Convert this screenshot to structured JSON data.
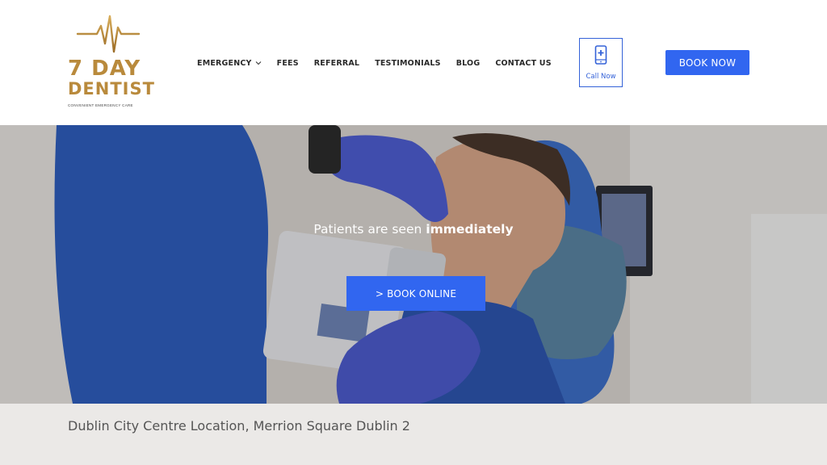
{
  "header": {
    "logo": {
      "line1": "7 DAY",
      "line2": "DENTIST",
      "tagline": "CONVENIENT EMERGENCY CARE",
      "icon": "heartbeat-tooth-icon",
      "color": "#b98a3c"
    },
    "nav": {
      "items": [
        {
          "label": "EMERGENCY",
          "has_dropdown": true
        },
        {
          "label": "FEES"
        },
        {
          "label": "REFERRAL"
        },
        {
          "label": "TESTIMONIALS"
        },
        {
          "label": "BLOG"
        },
        {
          "label": "CONTACT US"
        }
      ]
    },
    "call": {
      "label": "Call Now",
      "icon": "phone-plus-icon"
    },
    "book_now": "BOOK NOW"
  },
  "hero": {
    "text_prefix": "Patients are seen ",
    "text_emphasis": "immediately",
    "cta": "> BOOK ONLINE",
    "image": "dentist-patient-xray-photo"
  },
  "location": {
    "text": "Dublin City Centre Location, Merrion Square Dublin 2"
  },
  "colors": {
    "accent": "#3166f0",
    "gold": "#b98a3c",
    "location_bg": "#ebe9e7"
  }
}
